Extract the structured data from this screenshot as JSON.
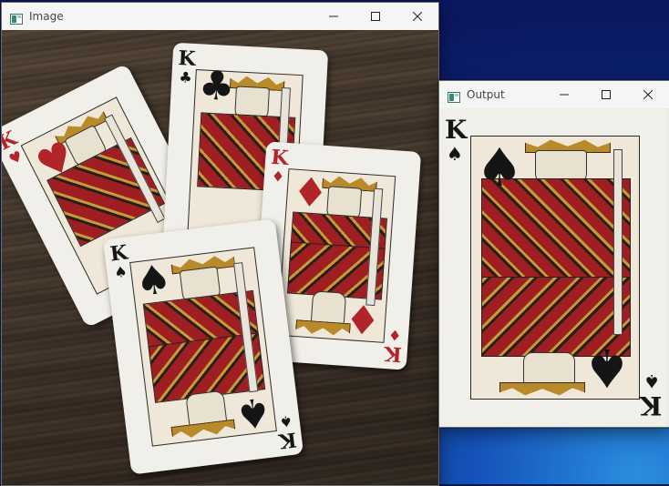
{
  "windows": {
    "image": {
      "title": "Image"
    },
    "output": {
      "title": "Output"
    }
  },
  "controls": {
    "minimize": "—",
    "maximize": "☐",
    "close": "✕"
  },
  "cards": [
    {
      "rank": "K",
      "suit": "♥",
      "color": "red"
    },
    {
      "rank": "K",
      "suit": "♣",
      "color": "black"
    },
    {
      "rank": "K",
      "suit": "♦",
      "color": "red"
    },
    {
      "rank": "K",
      "suit": "♠",
      "color": "black"
    }
  ],
  "output_card": {
    "rank": "K",
    "suit": "♠",
    "color": "black"
  },
  "colors": {
    "card_red": "#b0242a",
    "card_black": "#151515",
    "titlebar": "#f5f5f5",
    "wallpaper": "#0b1760"
  }
}
